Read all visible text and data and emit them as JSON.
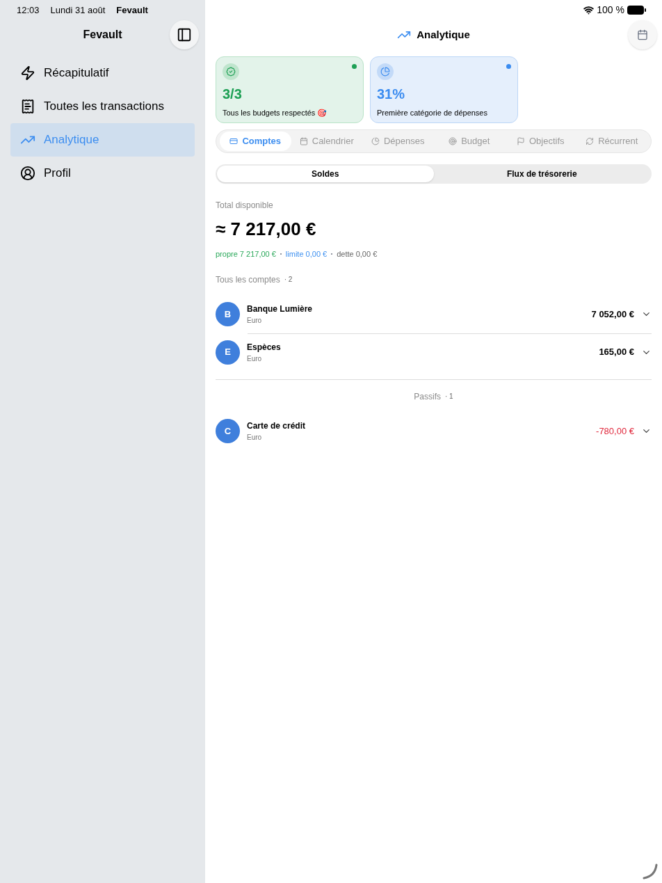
{
  "status_bar": {
    "time": "12:03",
    "date": "Lundi 31 août",
    "app": "Fevault",
    "battery": "100 %"
  },
  "sidebar": {
    "title": "Fevault",
    "items": [
      {
        "label": "Récapitulatif",
        "kind": "bolt",
        "selected": false
      },
      {
        "label": "Toutes les transactions",
        "kind": "list",
        "selected": false
      },
      {
        "label": "Analytique",
        "kind": "chart",
        "selected": true
      },
      {
        "label": "Profil",
        "kind": "person",
        "selected": false
      }
    ]
  },
  "header": {
    "title": "Analytique"
  },
  "cards": [
    {
      "kind": "green",
      "value": "3/3",
      "label": "Tous les budgets respectés 🎯",
      "color": "#1ea055"
    },
    {
      "kind": "blue",
      "value": "31%",
      "label": "Première catégorie de dépenses",
      "color": "#3b8cf0"
    }
  ],
  "tabs": [
    {
      "label": "Comptes",
      "kind": "card",
      "selected": true
    },
    {
      "label": "Calendrier",
      "kind": "calendar",
      "selected": false
    },
    {
      "label": "Dépenses",
      "kind": "pie",
      "selected": false
    },
    {
      "label": "Budget",
      "kind": "target",
      "selected": false
    },
    {
      "label": "Objectifs",
      "kind": "flag",
      "selected": false
    },
    {
      "label": "Récurrent",
      "kind": "repeat",
      "selected": false
    }
  ],
  "segments": [
    {
      "label": "Soldes",
      "selected": true
    },
    {
      "label": "Flux de trésorerie",
      "selected": false
    }
  ],
  "total": {
    "label": "Total disponible",
    "value": "≈ 7 217,00 €",
    "breakdown": [
      {
        "text": "propre 7 217,00 €",
        "color": "#2aa85a"
      },
      {
        "text": "limite 0,00 €",
        "color": "#3d90f0"
      },
      {
        "text": "dette 0,00 €",
        "color": "#666666"
      }
    ]
  },
  "groups": [
    {
      "title": "Tous les comptes",
      "count": "· 2",
      "centered": false,
      "accounts": [
        {
          "initial": "B",
          "name": "Banque Lumière",
          "currency": "Euro",
          "amount": "7 052,00 €",
          "negative": false
        },
        {
          "initial": "E",
          "name": "Espèces",
          "currency": "Euro",
          "amount": "165,00 €",
          "negative": false
        }
      ]
    },
    {
      "title": "Passifs",
      "count": "· 1",
      "centered": true,
      "accounts": [
        {
          "initial": "C",
          "name": "Carte de crédit",
          "currency": "Euro",
          "amount": "-780,00 €",
          "negative": true
        }
      ]
    }
  ]
}
